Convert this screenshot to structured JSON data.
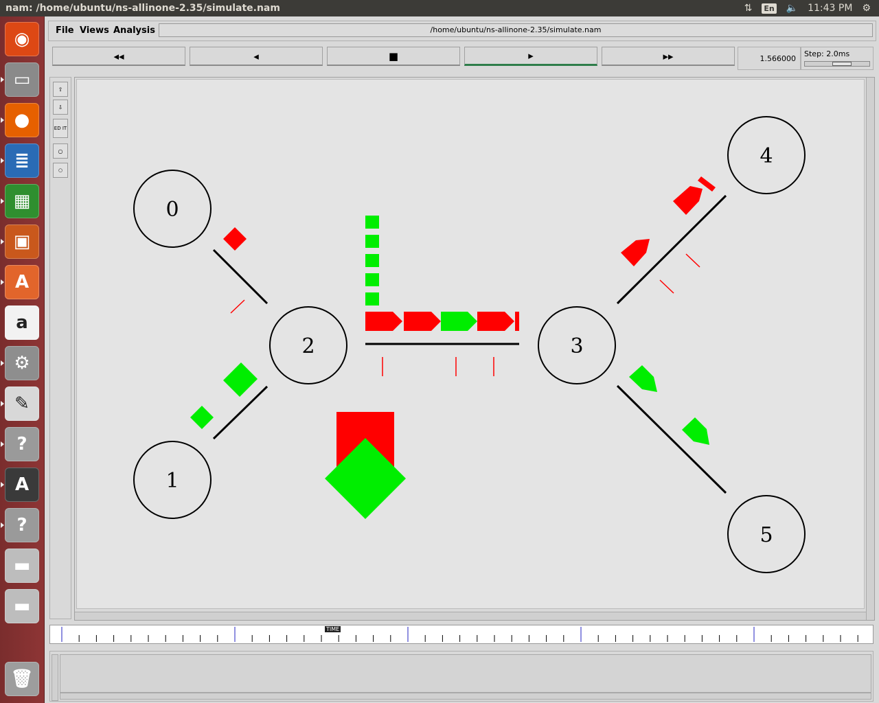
{
  "window": {
    "title": "nam: /home/ubuntu/ns-allinone-2.35/simulate.nam"
  },
  "panel": {
    "lang": "En",
    "clock": "11:43 PM"
  },
  "launcher": {
    "items": [
      {
        "name": "ubuntu-dash-icon",
        "glyph": "◉",
        "color": "#dd4814"
      },
      {
        "name": "files-icon",
        "glyph": "▭",
        "color": "#8a8a8a"
      },
      {
        "name": "firefox-icon",
        "glyph": "●",
        "color": "#e66000"
      },
      {
        "name": "writer-icon",
        "glyph": "≣",
        "color": "#2a6bb5"
      },
      {
        "name": "calc-icon",
        "glyph": "▦",
        "color": "#2f8f2f"
      },
      {
        "name": "impress-icon",
        "glyph": "▣",
        "color": "#c9581c"
      },
      {
        "name": "software-center-icon",
        "glyph": "A",
        "color": "#e2652b"
      },
      {
        "name": "amazon-icon",
        "glyph": "a",
        "color": "#f2f2f2"
      },
      {
        "name": "system-settings-icon",
        "glyph": "⚙",
        "color": "#8e8e8e"
      },
      {
        "name": "text-editor-icon",
        "glyph": "✎",
        "color": "#d8d8d8"
      },
      {
        "name": "unknown-app-icon",
        "glyph": "?",
        "color": "#9a9a9a"
      },
      {
        "name": "software-updater-icon",
        "glyph": "A",
        "color": "#3a3a3a"
      },
      {
        "name": "unknown-app-icon-2",
        "glyph": "?",
        "color": "#9a9a9a"
      },
      {
        "name": "drive-icon",
        "glyph": "▬",
        "color": "#bdbdbd"
      },
      {
        "name": "drive-icon-2",
        "glyph": "▬",
        "color": "#bdbdbd"
      },
      {
        "name": "trash-icon",
        "glyph": "🗑",
        "color": "#9d9d9d"
      }
    ]
  },
  "menubar": {
    "file": "File",
    "views": "Views",
    "analysis": "Analysis",
    "path": "/home/ubuntu/ns-allinone-2.35/simulate.nam"
  },
  "controls": {
    "rewind": "◂◂",
    "back": "◂",
    "stop": "■",
    "play": "▸",
    "fastforward": "▸▸",
    "time": "1.566000",
    "step_label": "Step: 2.0ms"
  },
  "tools": {
    "edit": "ED IT"
  },
  "timeline": {
    "label": "TIME"
  },
  "topology": {
    "nodes": [
      {
        "id": "0",
        "label": "0"
      },
      {
        "id": "1",
        "label": "1"
      },
      {
        "id": "2",
        "label": "2"
      },
      {
        "id": "3",
        "label": "3"
      },
      {
        "id": "4",
        "label": "4"
      },
      {
        "id": "5",
        "label": "5"
      }
    ],
    "colors": {
      "red": "#ff0000",
      "green": "#00ee00",
      "link": "#000000"
    }
  }
}
